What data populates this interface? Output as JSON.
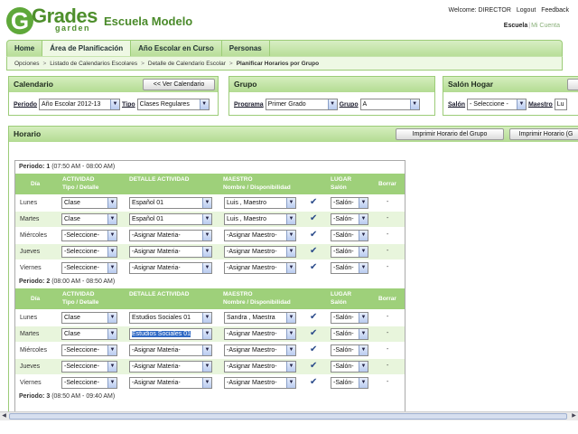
{
  "brand": {
    "logo_word": "Grades",
    "logo_sub": "garden",
    "school": "Escuela Modelo"
  },
  "top": {
    "welcome": "Welcome: DIRECTOR",
    "logout": "Logout",
    "feedback": "Feedback",
    "escuela": "Escuela",
    "mi_cuenta": "Mi Cuenta"
  },
  "nav": {
    "tabs": [
      "Home",
      "Área de Planificación",
      "Año Escolar en Curso",
      "Personas"
    ]
  },
  "breadcrumb": [
    "Opciones",
    "Listado de Calendarios Escolares",
    "Detalle de Calendario Escolar",
    "Planificar Horarios por Grupo"
  ],
  "calendario": {
    "title": "Calendario",
    "button": "<< Ver Calendario",
    "periodo_label": "Periodo",
    "periodo_value": "Año Escolar 2012-13",
    "tipo_label": "Tipo",
    "tipo_value": "Clases Regulares"
  },
  "grupo": {
    "title": "Grupo",
    "programa_label": "Programa",
    "programa_value": "Primer Grado",
    "grupo_label": "Grupo",
    "grupo_value": "A"
  },
  "salon": {
    "title": "Salón Hogar",
    "salon_label": "Salón",
    "salon_value": "- Seleccione -",
    "maestro_label": "Maestro",
    "maestro_value": "Lu"
  },
  "horario": {
    "title": "Horario",
    "print_group": "Imprimir Horario del Grupo",
    "print_other": "Imprimir Horario (G"
  },
  "headers": {
    "dia": "Día",
    "actividad": "ACTIVIDAD",
    "tipo_detalle": "Tipo / Detalle",
    "detalle": "DETALLE ACTIVIDAD",
    "maestro": "MAESTRO",
    "nombre_disp": "Nombre / Disponibilidad",
    "lugar": "LUGAR",
    "salon": "Salón",
    "borrar": "Borrar"
  },
  "periods": [
    {
      "label": "Periodo: 1",
      "time": "(07:50 AM - 08:00 AM)",
      "rows": [
        {
          "day": "Lunes",
          "tipo": "Clase",
          "detalle": "Español 01",
          "maestro": "Luis , Maestro",
          "salon": "-Salón-",
          "borrar": "-"
        },
        {
          "day": "Martes",
          "tipo": "Clase",
          "detalle": "Español 01",
          "maestro": "Luis , Maestro",
          "salon": "-Salón-",
          "borrar": "-"
        },
        {
          "day": "Miércoles",
          "tipo": "-Seleccione-",
          "detalle": "-Asignar Materia-",
          "maestro": "-Asignar Maestro-",
          "salon": "-Salón-",
          "borrar": "-"
        },
        {
          "day": "Jueves",
          "tipo": "-Seleccione-",
          "detalle": "-Asignar Materia-",
          "maestro": "-Asignar Maestro-",
          "salon": "-Salón-",
          "borrar": "-"
        },
        {
          "day": "Viernes",
          "tipo": "-Seleccione-",
          "detalle": "-Asignar Materia-",
          "maestro": "-Asignar Maestro-",
          "salon": "-Salón-",
          "borrar": "-"
        }
      ]
    },
    {
      "label": "Periodo: 2",
      "time": "(08:00 AM - 08:50 AM)",
      "rows": [
        {
          "day": "Lunes",
          "tipo": "Clase",
          "detalle": "Estudios Sociales 01",
          "maestro": "Sandra , Maestra",
          "salon": "-Salón-",
          "borrar": "-"
        },
        {
          "day": "Martes",
          "tipo": "Clase",
          "detalle": "Estudios Sociales 01",
          "maestro": "-Asignar Maestro-",
          "salon": "-Salón-",
          "borrar": "-"
        },
        {
          "day": "Miércoles",
          "tipo": "-Seleccione-",
          "detalle": "-Asignar Materia-",
          "maestro": "-Asignar Maestro-",
          "salon": "-Salón-",
          "borrar": "-"
        },
        {
          "day": "Jueves",
          "tipo": "-Seleccione-",
          "detalle": "-Asignar Materia-",
          "maestro": "-Asignar Maestro-",
          "salon": "-Salón-",
          "borrar": "-"
        },
        {
          "day": "Viernes",
          "tipo": "-Seleccione-",
          "detalle": "-Asignar Materia-",
          "maestro": "-Asignar Maestro-",
          "salon": "-Salón-",
          "borrar": "-"
        }
      ]
    },
    {
      "label": "Periodo: 3",
      "time": "(08:50 AM - 09:40 AM)",
      "rows": []
    }
  ]
}
